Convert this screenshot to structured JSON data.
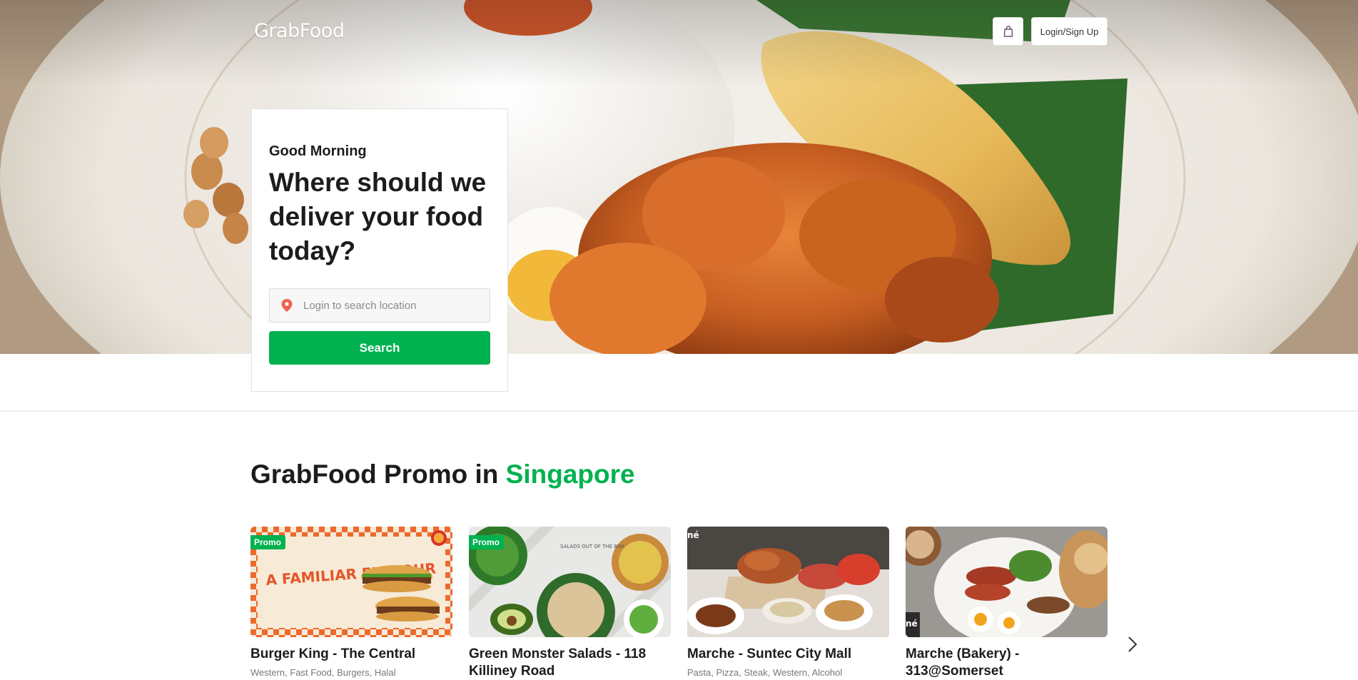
{
  "header": {
    "logo_text": "GrabFood",
    "cart_icon": "shopping-bag-icon",
    "login_label": "Login/Sign Up"
  },
  "hero": {
    "greeting": "Good Morning",
    "headline": "Where should we deliver your food today?",
    "location_placeholder": "Login to search location",
    "location_icon": "location-pin-icon",
    "search_label": "Search"
  },
  "promo": {
    "title_prefix": "GrabFood Promo in ",
    "title_city": "Singapore",
    "next_icon": "chevron-right-icon",
    "restaurants": [
      {
        "name": "Burger King - The Central",
        "cuisine": "Western, Fast Food, Burgers, Halal",
        "badge": "Promo",
        "image_text": "A FAMILIAR FLAVOUR"
      },
      {
        "name": "Green Monster Salads - 118 Killiney Road",
        "cuisine": "",
        "badge": "Promo",
        "image_text": "SALADS OUT OF THE BOX"
      },
      {
        "name": "Marche - Suntec City Mall",
        "cuisine": "Pasta, Pizza, Steak, Western, Alcohol",
        "badge": "",
        "image_text": ""
      },
      {
        "name": "Marche (Bakery) - 313@Somerset",
        "cuisine": "",
        "badge": "",
        "image_text": ""
      }
    ]
  },
  "colors": {
    "brand_green": "#00b14f",
    "promo_badge": "#00b14f"
  }
}
